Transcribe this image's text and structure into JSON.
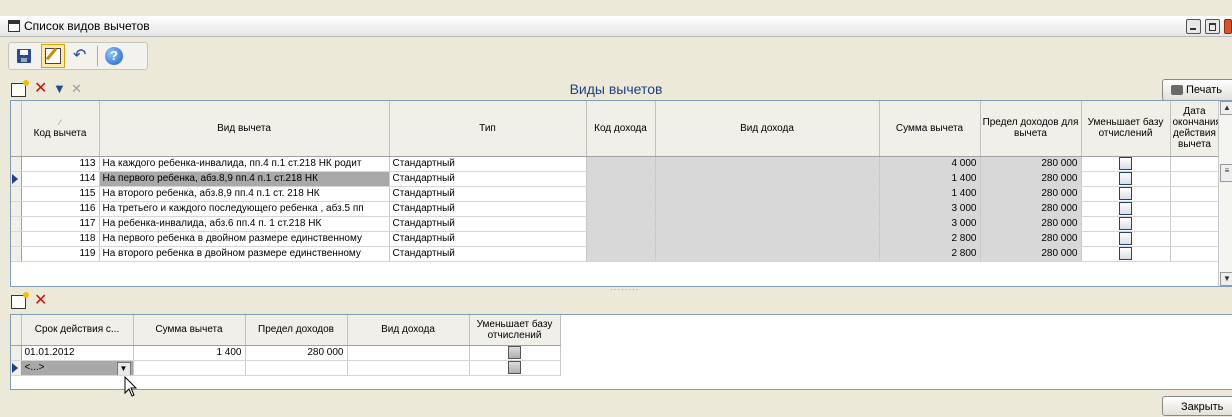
{
  "window": {
    "title": "Список видов вычетов"
  },
  "main_toolbar": {
    "save_icon": "save-icon",
    "edit_icon": "edit-icon",
    "undo_icon": "undo-icon",
    "help_icon": "help-icon",
    "help_glyph": "?"
  },
  "deductions": {
    "title": "Виды вычетов",
    "print_label": "Печать",
    "columns": [
      "Код вычета",
      "Вид вычета",
      "Тип",
      "Код дохода",
      "Вид дохода",
      "Сумма вычета",
      "Предел доходов для вычета",
      "Уменьшает базу отчислений",
      "Дата окончания действия вычета"
    ],
    "rows": [
      {
        "code": "113",
        "name": "На каждого ребенка-инвалида, пп.4 п.1 ст.218 НК родит",
        "type": "Стандартный",
        "amount": "4 000",
        "limit": "280 000"
      },
      {
        "code": "114",
        "name": "На первого ребенка, абз.8,9 пп.4 п.1 ст.218 НК",
        "type": "Стандартный",
        "amount": "1 400",
        "limit": "280 000"
      },
      {
        "code": "115",
        "name": "На второго ребенка, абз.8,9 пп.4 п.1 ст. 218 НК",
        "type": "Стандартный",
        "amount": "1 400",
        "limit": "280 000"
      },
      {
        "code": "116",
        "name": "На третьего и каждого последующего ребенка , абз.5 пп",
        "type": "Стандартный",
        "amount": "3 000",
        "limit": "280 000"
      },
      {
        "code": "117",
        "name": "На ребенка-инвалида, абз.6 пп.4 п. 1 ст.218 НК",
        "type": "Стандартный",
        "amount": "3 000",
        "limit": "280 000"
      },
      {
        "code": "118",
        "name": "На первого ребенка в двойном размере единственному",
        "type": "Стандартный",
        "amount": "2 800",
        "limit": "280 000"
      },
      {
        "code": "119",
        "name": "На второго ребенка в двойном размере единственному",
        "type": "Стандартный",
        "amount": "2 800",
        "limit": "280 000"
      }
    ],
    "selected_row": "114"
  },
  "periods": {
    "columns": [
      "Срок действия с...",
      "Сумма вычета",
      "Предел доходов",
      "Вид дохода",
      "Уменьшает базу отчислений"
    ],
    "rows": [
      {
        "from": "01.01.2012",
        "amount": "1 400",
        "limit": "280 000",
        "income": ""
      }
    ],
    "new_row_value": "<...>"
  },
  "footer": {
    "close_label": "Закрыть"
  }
}
